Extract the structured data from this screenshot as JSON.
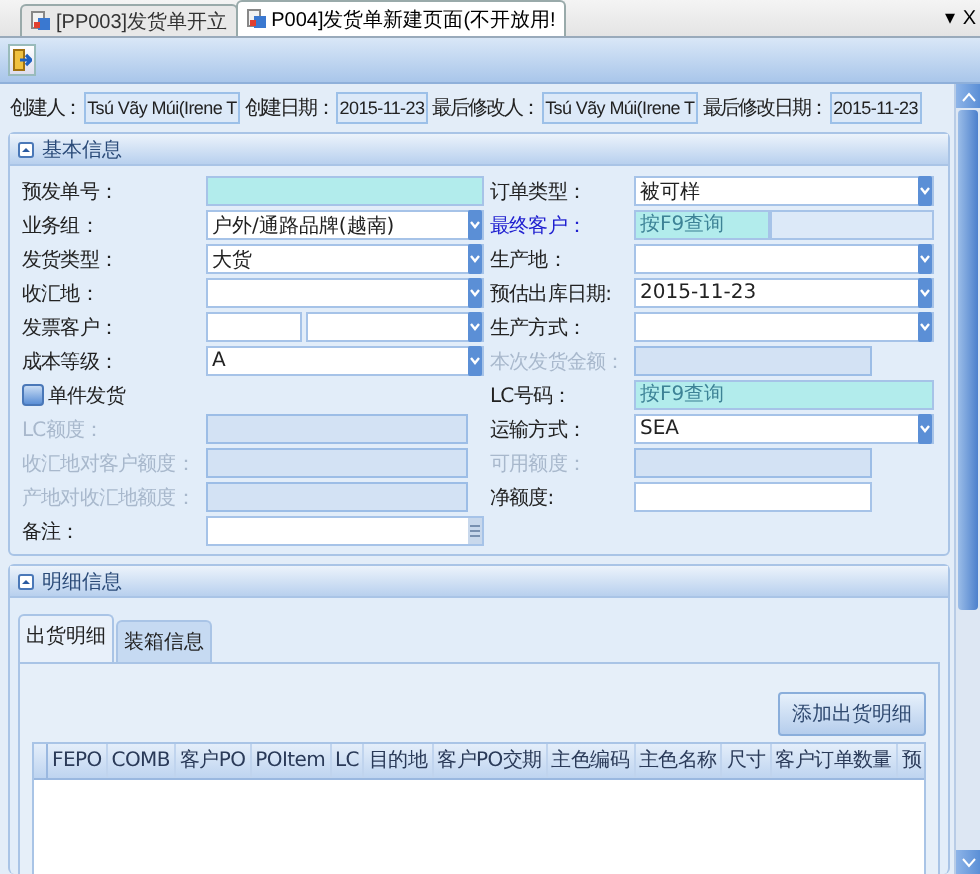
{
  "document_tabs": [
    {
      "label": "[PP003]发货单开立",
      "selected": false
    },
    {
      "label": "P004]发货单新建页面(不开放用!",
      "selected": true
    }
  ],
  "tab_strip_controls": {
    "menu": "▾",
    "close": "X"
  },
  "audit": [
    {
      "label": "创建人：",
      "value": "Tsú Vãy Múi(Irene T"
    },
    {
      "label": "创建日期：",
      "value": "2015-11-23"
    },
    {
      "label": "最后修改人：",
      "value": "Tsú Vãy Múi(Irene T"
    },
    {
      "label": "最后修改日期：",
      "value": "2015-11-23"
    }
  ],
  "basic_info": {
    "title": "基本信息",
    "fields": [
      {
        "label": "预发单号：",
        "kind": "input",
        "disabled": false,
        "required": true,
        "highlighted": false
      },
      {
        "label": "订单类型：",
        "kind": "dropdown",
        "value": "被可样",
        "disabled": false,
        "required": false,
        "highlighted": false
      },
      {
        "label": "业务组：",
        "kind": "dropdown",
        "value": "户外/通路品牌(越南)",
        "disabled": false,
        "required": false,
        "highlighted": false
      },
      {
        "label": "最终客户：",
        "kind": "lookup",
        "placeholder": "按F9查询",
        "disabled": false,
        "required": true,
        "highlighted": true
      },
      {
        "label": "发货类型：",
        "kind": "dropdown",
        "value": "大货",
        "disabled": false,
        "required": false,
        "highlighted": false
      },
      {
        "label": "生产地：",
        "kind": "dropdown",
        "disabled": false,
        "required": false,
        "highlighted": false
      },
      {
        "label": "收汇地：",
        "kind": "dropdown",
        "disabled": false,
        "required": false,
        "highlighted": false
      },
      {
        "label": "预估出库日期:",
        "kind": "dropdown",
        "value": "2015-11-23",
        "disabled": false,
        "required": false,
        "highlighted": false
      },
      {
        "label": "发票客户：",
        "kind": "dual",
        "disabled": false,
        "required": false,
        "highlighted": false
      },
      {
        "label": "生产方式：",
        "kind": "dropdown",
        "disabled": false,
        "required": false,
        "highlighted": false
      },
      {
        "label": "成本等级：",
        "kind": "dropdown",
        "value": "A",
        "disabled": false,
        "required": false,
        "highlighted": false
      },
      {
        "label": "本次发货金额：",
        "kind": "input",
        "disabled": true,
        "required": false,
        "highlighted": false
      },
      {
        "label": "单件发货",
        "kind": "checkbox",
        "checked": false
      },
      {
        "label": "LC号码：",
        "kind": "input",
        "placeholder": "按F9查询",
        "disabled": false,
        "required": true,
        "highlighted": false
      },
      {
        "label": "LC额度：",
        "kind": "input",
        "disabled": true,
        "required": false,
        "highlighted": false
      },
      {
        "label": "运输方式：",
        "kind": "dropdown",
        "value": "SEA",
        "disabled": false,
        "required": false,
        "highlighted": false
      },
      {
        "label": "收汇地对客户额度：",
        "kind": "input",
        "disabled": true,
        "required": false,
        "highlighted": false
      },
      {
        "label": "可用额度：",
        "kind": "input",
        "disabled": true,
        "required": false,
        "highlighted": false
      },
      {
        "label": "产地对收汇地额度：",
        "kind": "input",
        "disabled": true,
        "required": false,
        "highlighted": false
      },
      {
        "label": "净额度:",
        "kind": "input",
        "disabled": false,
        "required": false,
        "highlighted": false
      },
      {
        "label": "备注：",
        "kind": "memo",
        "disabled": false,
        "required": false,
        "highlighted": false
      }
    ]
  },
  "detail_info": {
    "title": "明细信息",
    "tabs": [
      {
        "label": "出货明细",
        "selected": true
      },
      {
        "label": "装箱信息",
        "selected": false
      }
    ],
    "add_button": "添加出货明细",
    "grid": {
      "columns": [
        "FEPO",
        "COMB",
        "客户PO",
        "POItem",
        "LC",
        "目的地",
        "客户PO交期",
        "主色编码",
        "主色名称",
        "尺寸",
        "客户订单数量",
        "预"
      ]
    }
  }
}
